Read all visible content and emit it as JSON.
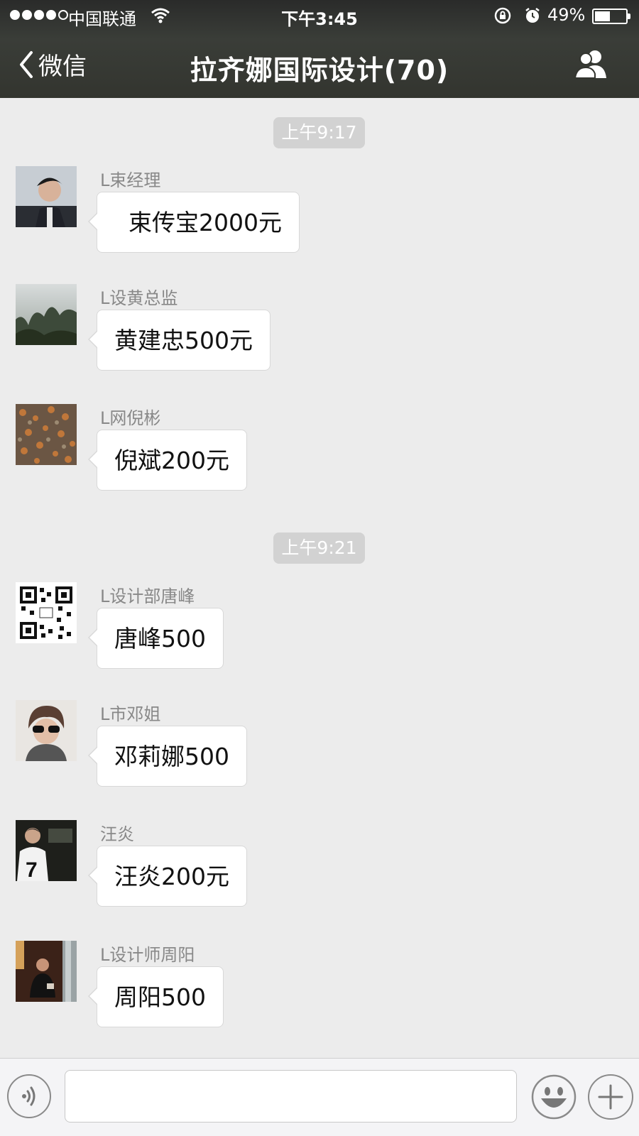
{
  "status_bar": {
    "carrier": "中国联通",
    "time": "下午3:45",
    "battery_percent": "49%",
    "battery_level": 0.49,
    "icons": [
      "signal-dots-icon",
      "wifi-icon",
      "orientation-lock-icon",
      "alarm-icon",
      "battery-icon"
    ]
  },
  "nav": {
    "back_label": "微信",
    "title": "拉齐娜国际设计(70)",
    "right_icon": "group-members-icon"
  },
  "timestamps": [
    "上午9:17",
    "上午9:21"
  ],
  "messages": [
    {
      "sender": "L束经理",
      "text": "束传宝2000元"
    },
    {
      "sender": "L设黄总监",
      "text": "黄建忠500元"
    },
    {
      "sender": "L网倪彬",
      "text": "倪斌200元"
    },
    {
      "sender": "L设计部唐峰",
      "text": "唐峰500"
    },
    {
      "sender": "L市邓姐",
      "text": "邓莉娜500"
    },
    {
      "sender": "汪炎",
      "text": "汪炎200元"
    },
    {
      "sender": "L设计师周阳",
      "text": "周阳500"
    }
  ],
  "input_bar": {
    "value": "",
    "icons": [
      "voice-icon",
      "emoji-icon",
      "plus-icon"
    ]
  },
  "colors": {
    "nav_background": "#33352f",
    "chat_background": "#ececec",
    "bubble": "#ffffff",
    "timestamp_badge": "#d2d2d2"
  }
}
